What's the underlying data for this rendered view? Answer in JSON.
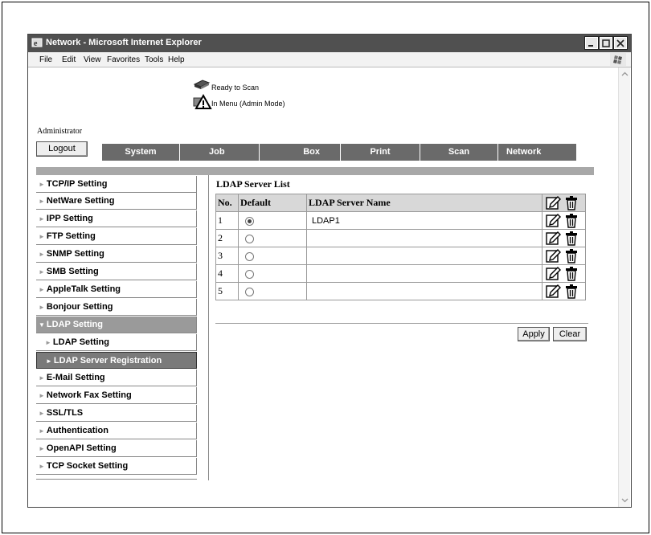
{
  "window": {
    "title": "Network - Microsoft Internet Explorer"
  },
  "menu": [
    "File",
    "Edit",
    "View",
    "Favorites",
    "Tools",
    "Help"
  ],
  "status": {
    "line1": "Ready to Scan",
    "line2": "In Menu (Admin Mode)"
  },
  "user": {
    "label": "Administrator",
    "logout": "Logout"
  },
  "tabs": [
    "System",
    "Job",
    "Box",
    "Print",
    "Scan",
    "Network"
  ],
  "sidebar": [
    "TCP/IP Setting",
    "NetWare Setting",
    "IPP Setting",
    "FTP Setting",
    "SNMP Setting",
    "SMB Setting",
    "AppleTalk Setting",
    "Bonjour Setting",
    "LDAP Setting",
    "LDAP Setting",
    "LDAP Server Registration",
    "E-Mail Setting",
    "Network Fax Setting",
    "SSL/TLS",
    "Authentication",
    "OpenAPI Setting",
    "TCP Socket Setting"
  ],
  "ldap": {
    "title": "LDAP Server List",
    "headers": {
      "no": "No.",
      "default": "Default",
      "name": "LDAP Server Name"
    },
    "rows": [
      {
        "no": "1",
        "name": "LDAP1",
        "default": true
      },
      {
        "no": "2",
        "name": "",
        "default": false
      },
      {
        "no": "3",
        "name": "",
        "default": false
      },
      {
        "no": "4",
        "name": "",
        "default": false
      },
      {
        "no": "5",
        "name": "",
        "default": false
      }
    ]
  },
  "buttons": {
    "apply": "Apply",
    "clear": "Clear"
  },
  "icons": {
    "edit": "edit-icon",
    "delete": "trash-icon",
    "printer": "printer-icon",
    "warning": "warning-icon"
  }
}
